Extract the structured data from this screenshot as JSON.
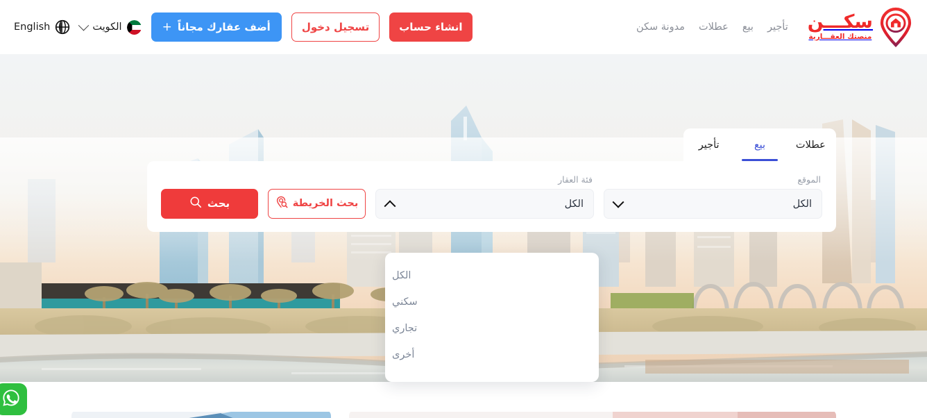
{
  "header": {
    "logo": {
      "title": "سكـــن",
      "subtitle": "منصتك العقـــارية",
      "mark_icon": "location-pin-house-icon",
      "brand_color": "#ef2a2a"
    },
    "nav": [
      {
        "label": "تأجير"
      },
      {
        "label": "بيع"
      },
      {
        "label": "عطلات"
      },
      {
        "label": "مدونة سكن"
      }
    ],
    "language": {
      "label": "English",
      "icon": "globe-icon"
    },
    "country": {
      "label": "الكويت",
      "flag": "kuwait-flag-icon",
      "chevron": "chevron-down-icon"
    },
    "add_property_button": {
      "label": "أضف عقارك مجاناً",
      "plus": "+",
      "color": "#3d95f5"
    },
    "login_button": {
      "label": "تسجيل دخول",
      "color": "#ef4444"
    },
    "signup_button": {
      "label": "انشاء حساب",
      "color": "#ef4444"
    }
  },
  "search_widget": {
    "tabs": [
      {
        "label": "تأجير",
        "active": false
      },
      {
        "label": "بيع",
        "active": true
      },
      {
        "label": "عطلات",
        "active": false
      }
    ],
    "active_tab_color": "#3b4fd6",
    "location_field": {
      "label": "الموقع",
      "value": "الكل",
      "chevron": "chevron-down-icon"
    },
    "category_field": {
      "label": "فئة العقار",
      "value": "الكل",
      "chevron": "chevron-up-icon",
      "open": true,
      "options": [
        {
          "label": "الكل"
        },
        {
          "label": "سكني"
        },
        {
          "label": "تجاري"
        },
        {
          "label": "أخرى"
        }
      ]
    },
    "map_search_button": {
      "label": "بحث الخريطة",
      "icon": "map-pin-search-icon"
    },
    "search_button": {
      "label": "بحث",
      "icon": "search-icon",
      "color": "#ef3b3b"
    }
  },
  "floating": {
    "whatsapp": {
      "icon": "whatsapp-icon",
      "color": "#2fbf3f"
    }
  }
}
